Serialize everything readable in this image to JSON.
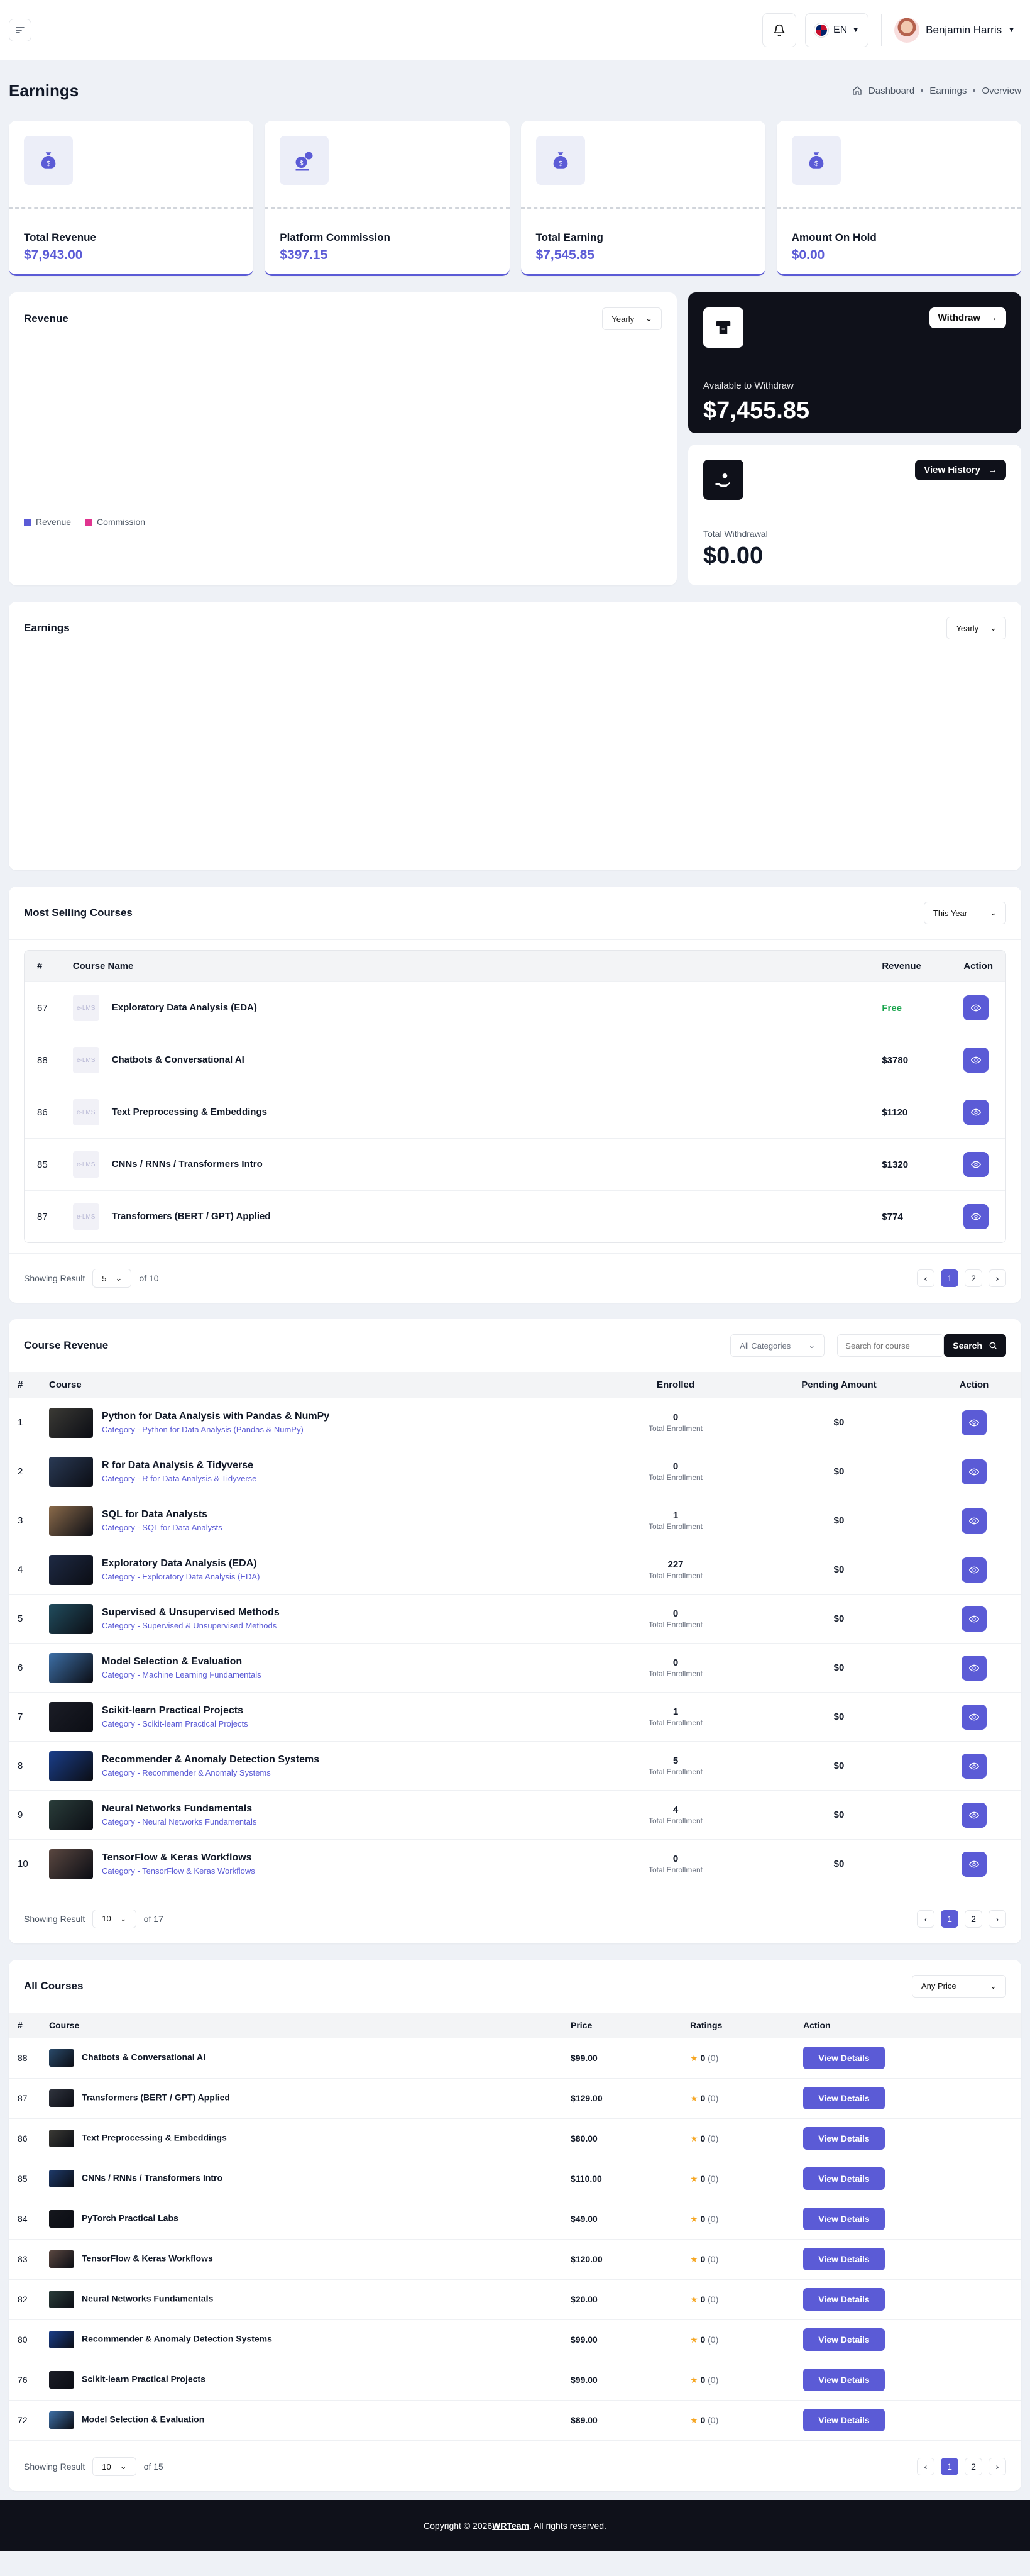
{
  "header": {
    "lang": "EN",
    "user": "Benjamin Harris"
  },
  "page": {
    "title": "Earnings",
    "breadcrumb": [
      "Dashboard",
      "Earnings",
      "Overview"
    ]
  },
  "stats": [
    {
      "label": "Total Revenue",
      "value": "$7,943.00"
    },
    {
      "label": "Platform Commission",
      "value": "$397.15"
    },
    {
      "label": "Total Earning",
      "value": "$7,545.85"
    },
    {
      "label": "Amount On Hold",
      "value": "$0.00"
    }
  ],
  "revenue": {
    "title": "Revenue",
    "period": "Yearly",
    "legend": [
      "Revenue",
      "Commission"
    ]
  },
  "withdraw": {
    "button": "Withdraw",
    "label": "Available to Withdraw",
    "value": "$7,455.85"
  },
  "history": {
    "button": "View History",
    "label": "Total Withdrawal",
    "value": "$0.00"
  },
  "earnings": {
    "title": "Earnings",
    "period": "Yearly"
  },
  "most_selling": {
    "title": "Most Selling Courses",
    "period": "This Year",
    "headers": [
      "#",
      "Course Name",
      "Revenue",
      "Action"
    ],
    "rows": [
      {
        "id": "67",
        "name": "Exploratory Data Analysis (EDA)",
        "revenue": "Free"
      },
      {
        "id": "88",
        "name": "Chatbots & Conversational AI",
        "revenue": "$3780"
      },
      {
        "id": "86",
        "name": "Text Preprocessing & Embeddings",
        "revenue": "$1120"
      },
      {
        "id": "85",
        "name": "CNNs / RNNs / Transformers Intro",
        "revenue": "$1320"
      },
      {
        "id": "87",
        "name": "Transformers (BERT / GPT) Applied",
        "revenue": "$774"
      }
    ],
    "thumb_text": "e-LMS",
    "showing": "Showing Result",
    "per_page": "5",
    "of": "of 10",
    "pages": [
      "1",
      "2"
    ]
  },
  "course_revenue": {
    "title": "Course Revenue",
    "category": "All Categories",
    "search_placeholder": "Search for course",
    "search_btn": "Search",
    "headers": [
      "#",
      "Course",
      "Enrolled",
      "Pending Amount",
      "Action"
    ],
    "enroll_sub": "Total Enrollment",
    "rows": [
      {
        "n": "1",
        "title": "Python for Data Analysis with Pandas & NumPy",
        "cat": "Category - Python for Data Analysis (Pandas & NumPy)",
        "enrolled": "0",
        "pending": "$0",
        "color": "#3b3a35"
      },
      {
        "n": "2",
        "title": "R for Data Analysis & Tidyverse",
        "cat": "Category - R for Data Analysis & Tidyverse",
        "enrolled": "0",
        "pending": "$0",
        "color": "#2a3a55"
      },
      {
        "n": "3",
        "title": "SQL for Data Analysts",
        "cat": "Category - SQL for Data Analysts",
        "enrolled": "1",
        "pending": "$0",
        "color": "#8a6a4a"
      },
      {
        "n": "4",
        "title": "Exploratory Data Analysis (EDA)",
        "cat": "Category - Exploratory Data Analysis (EDA)",
        "enrolled": "227",
        "pending": "$0",
        "color": "#1e2a44"
      },
      {
        "n": "5",
        "title": "Supervised & Unsupervised Methods",
        "cat": "Category - Supervised & Unsupervised Methods",
        "enrolled": "0",
        "pending": "$0",
        "color": "#214d5e"
      },
      {
        "n": "6",
        "title": "Model Selection & Evaluation",
        "cat": "Category - Machine Learning Fundamentals",
        "enrolled": "0",
        "pending": "$0",
        "color": "#3d6fa6"
      },
      {
        "n": "7",
        "title": "Scikit-learn Practical Projects",
        "cat": "Category - Scikit-learn Practical Projects",
        "enrolled": "1",
        "pending": "$0",
        "color": "#1b1d26"
      },
      {
        "n": "8",
        "title": "Recommender & Anomaly Detection Systems",
        "cat": "Category - Recommender & Anomaly Systems",
        "enrolled": "5",
        "pending": "$0",
        "color": "#1a3e8a"
      },
      {
        "n": "9",
        "title": "Neural Networks Fundamentals",
        "cat": "Category - Neural Networks Fundamentals",
        "enrolled": "4",
        "pending": "$0",
        "color": "#2a3d3a"
      },
      {
        "n": "10",
        "title": "TensorFlow & Keras Workflows",
        "cat": "Category - TensorFlow & Keras Workflows",
        "enrolled": "0",
        "pending": "$0",
        "color": "#5a4740"
      }
    ],
    "showing": "Showing Result",
    "per_page": "10",
    "of": "of 17",
    "pages": [
      "1",
      "2"
    ]
  },
  "all_courses": {
    "title": "All Courses",
    "price_filter": "Any Price",
    "headers": [
      "#",
      "Course",
      "Price",
      "Ratings",
      "Action"
    ],
    "rating": "0",
    "rating_count": "(0)",
    "btn": "View Details",
    "rows": [
      {
        "id": "88",
        "name": "Chatbots & Conversational AI",
        "price": "$99.00",
        "color": "#2a4a6a"
      },
      {
        "id": "87",
        "name": "Transformers (BERT / GPT) Applied",
        "price": "$129.00",
        "color": "#30343e"
      },
      {
        "id": "86",
        "name": "Text Preprocessing & Embeddings",
        "price": "$80.00",
        "color": "#3b3a35"
      },
      {
        "id": "85",
        "name": "CNNs / RNNs / Transformers Intro",
        "price": "$110.00",
        "color": "#1e3a6a"
      },
      {
        "id": "84",
        "name": "PyTorch Practical Labs",
        "price": "$49.00",
        "color": "#15171d"
      },
      {
        "id": "83",
        "name": "TensorFlow & Keras Workflows",
        "price": "$120.00",
        "color": "#5a4740"
      },
      {
        "id": "82",
        "name": "Neural Networks Fundamentals",
        "price": "$20.00",
        "color": "#2a3d3a"
      },
      {
        "id": "80",
        "name": "Recommender & Anomaly Detection Systems",
        "price": "$99.00",
        "color": "#1a3e8a"
      },
      {
        "id": "76",
        "name": "Scikit-learn Practical Projects",
        "price": "$99.00",
        "color": "#1b1d26"
      },
      {
        "id": "72",
        "name": "Model Selection & Evaluation",
        "price": "$89.00",
        "color": "#3d6fa6"
      }
    ],
    "showing": "Showing Result",
    "per_page": "10",
    "of": "of 15",
    "pages": [
      "1",
      "2"
    ]
  },
  "footer": {
    "pre": "Copyright © 2026 ",
    "brand": "WRTeam",
    "post": ". All rights reserved."
  }
}
